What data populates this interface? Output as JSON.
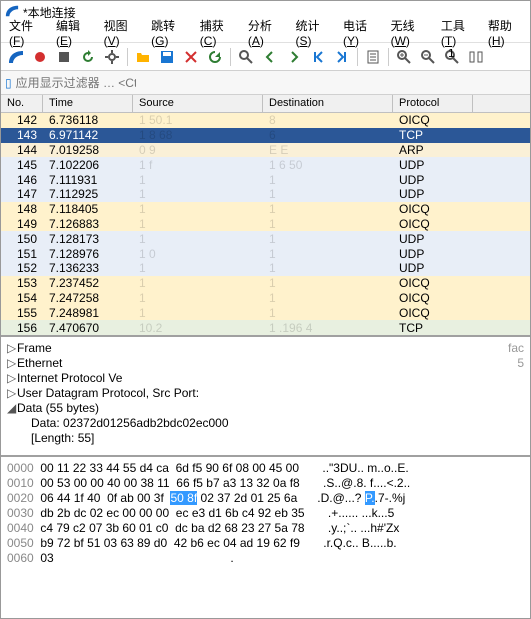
{
  "window": {
    "title": "*本地连接",
    "icon": "wireshark-fin-icon"
  },
  "menu": [
    {
      "label": "文件",
      "accel": "F"
    },
    {
      "label": "编辑",
      "accel": "E"
    },
    {
      "label": "视图",
      "accel": "V"
    },
    {
      "label": "跳转",
      "accel": "G"
    },
    {
      "label": "捕获",
      "accel": "C"
    },
    {
      "label": "分析",
      "accel": "A"
    },
    {
      "label": "统计",
      "accel": "S"
    },
    {
      "label": "电话",
      "accel": "Y"
    },
    {
      "label": "无线",
      "accel": "W"
    },
    {
      "label": "工具",
      "accel": "T"
    },
    {
      "label": "帮助",
      "accel": "H"
    }
  ],
  "toolbar_icons": [
    "fin",
    "circle-red",
    "square",
    "restart",
    "gear",
    "sep",
    "folder",
    "save",
    "close",
    "refresh",
    "sep",
    "find",
    "arrow-left",
    "arrow-right",
    "go-first",
    "go-last",
    "sep",
    "autoscroll",
    "sep",
    "zoom-in",
    "zoom-out",
    "zoom-reset",
    "resize-cols"
  ],
  "filterbar": {
    "placeholder": "应用显示过滤器 … <Ctrl-/>"
  },
  "columns": [
    "No.",
    "Time",
    "Source",
    "Destination",
    "Protocol"
  ],
  "packets": [
    {
      "no": "142",
      "time": "6.736118",
      "src": "1    50.1",
      "dst": "           8",
      "proto": "OICQ",
      "cls": "oicq"
    },
    {
      "no": "143",
      "time": "6.971142",
      "src": "1    8   68",
      "dst": "           6",
      "proto": "TCP",
      "cls": "sel"
    },
    {
      "no": "144",
      "time": "7.019258",
      "src": "0         9",
      "dst": "E         E",
      "proto": "ARP",
      "cls": "arp"
    },
    {
      "no": "145",
      "time": "7.102206",
      "src": "1         f",
      "dst": "1   6    50",
      "proto": "UDP",
      "cls": "udp"
    },
    {
      "no": "146",
      "time": "7.111931",
      "src": "1",
      "dst": "1",
      "proto": "UDP",
      "cls": "udp"
    },
    {
      "no": "147",
      "time": "7.112925",
      "src": "1",
      "dst": "1",
      "proto": "UDP",
      "cls": "udp"
    },
    {
      "no": "148",
      "time": "7.118405",
      "src": "1",
      "dst": "1",
      "proto": "OICQ",
      "cls": "oicq"
    },
    {
      "no": "149",
      "time": "7.126883",
      "src": "1",
      "dst": "1",
      "proto": "OICQ",
      "cls": "oicq"
    },
    {
      "no": "150",
      "time": "7.128173",
      "src": "1",
      "dst": "1",
      "proto": "UDP",
      "cls": "udp"
    },
    {
      "no": "151",
      "time": "7.128976",
      "src": "1     0",
      "dst": "1",
      "proto": "UDP",
      "cls": "udp"
    },
    {
      "no": "152",
      "time": "7.136233",
      "src": "1",
      "dst": "1",
      "proto": "UDP",
      "cls": "udp"
    },
    {
      "no": "153",
      "time": "7.237452",
      "src": "1",
      "dst": "1",
      "proto": "OICQ",
      "cls": "oicq"
    },
    {
      "no": "154",
      "time": "7.247258",
      "src": "1",
      "dst": "1",
      "proto": "OICQ",
      "cls": "oicq"
    },
    {
      "no": "155",
      "time": "7.248981",
      "src": "1",
      "dst": "1",
      "proto": "OICQ",
      "cls": "oicq"
    },
    {
      "no": "156",
      "time": "7.470670",
      "src": "10.2",
      "dst": "1   .196     4",
      "proto": "TCP",
      "cls": "tcp"
    }
  ],
  "tree": {
    "nodes": [
      {
        "caret": "▷",
        "text": "Frame",
        "tail": "fac"
      },
      {
        "caret": "▷",
        "text": "Ethernet ",
        "tail": "5"
      },
      {
        "caret": "▷",
        "text": "Internet Protocol Ve",
        "tail": ""
      },
      {
        "caret": "▷",
        "text": "User Datagram Protocol, Src Port:",
        "tail": ""
      },
      {
        "caret": "◢",
        "text": "Data (55 bytes)",
        "tail": ""
      }
    ],
    "sub": [
      "Data: 02372d01256adb2bdc02ec000",
      "[Length: 55]"
    ]
  },
  "hex": {
    "rows": [
      {
        "off": "0000",
        "b": "00 11 22 33 44 55 d4 ca  6d f5 90 6f 08 00 45 00",
        "a": "..\"3DU.. m..o..E."
      },
      {
        "off": "0010",
        "b": "00 53 00 00 40 00 38 11  66 f5 b7 a3 13 32 0a f8",
        "a": ".S..@.8. f....<.2.."
      },
      {
        "off": "0020",
        "b": "06 44 1f 40  0f ab 00 3f  ",
        "bh": "50 8f",
        "b2": " 02 37 2d 01 25 6a",
        "a": ".D.@...? ",
        "ah": "P.",
        "a2": ".7-.%j"
      },
      {
        "off": "0030",
        "b": "db 2b dc 02 ec 00 00 00  ec e3 d1 6b c4 92 eb 35",
        "a": ".+...... ...k...5"
      },
      {
        "off": "0040",
        "b": "c4 79 c2 07 3b 60 01 c0  dc ba d2 68 23 27 5a 78",
        "a": ".y..;`.. ...h#'Zx"
      },
      {
        "off": "0050",
        "b": "b9 72 bf 51 03 63 89 d0  42 b6 ec 04 ad 19 62 f9",
        "a": ".r.Q.c.. B.....b."
      },
      {
        "off": "0060",
        "b": "03",
        "a": "."
      }
    ]
  }
}
